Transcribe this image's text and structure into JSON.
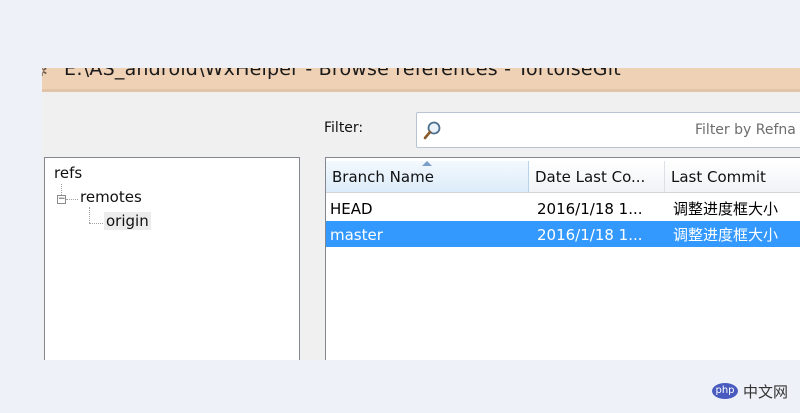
{
  "window": {
    "title": "E:\\AS_android\\WxHelper - Browse references - TortoiseGit",
    "icon": "tortoisegit-icon"
  },
  "filter": {
    "label": "Filter:",
    "placeholder": "Filter by Refna",
    "icon": "search-icon"
  },
  "tree": {
    "items": [
      {
        "label": "refs",
        "expanded": true
      },
      {
        "label": "remotes",
        "expanded": true
      },
      {
        "label": "origin",
        "selected": false
      }
    ]
  },
  "list": {
    "columns": [
      "Branch Name",
      "Date Last Co...",
      "Last Commit"
    ],
    "sorted_column": "Branch Name",
    "rows": [
      {
        "branch": "HEAD",
        "date": "2016/1/18 1...",
        "commit": "调整进度框大小",
        "selected": false
      },
      {
        "branch": "master",
        "date": "2016/1/18 1...",
        "commit": "调整进度框大小",
        "selected": true
      }
    ]
  },
  "watermark": {
    "logo_text": "php",
    "text": "中文网"
  },
  "colors": {
    "selection": "#3399ff",
    "titlebar": "#efd1b5",
    "background": "#eef2f8"
  }
}
